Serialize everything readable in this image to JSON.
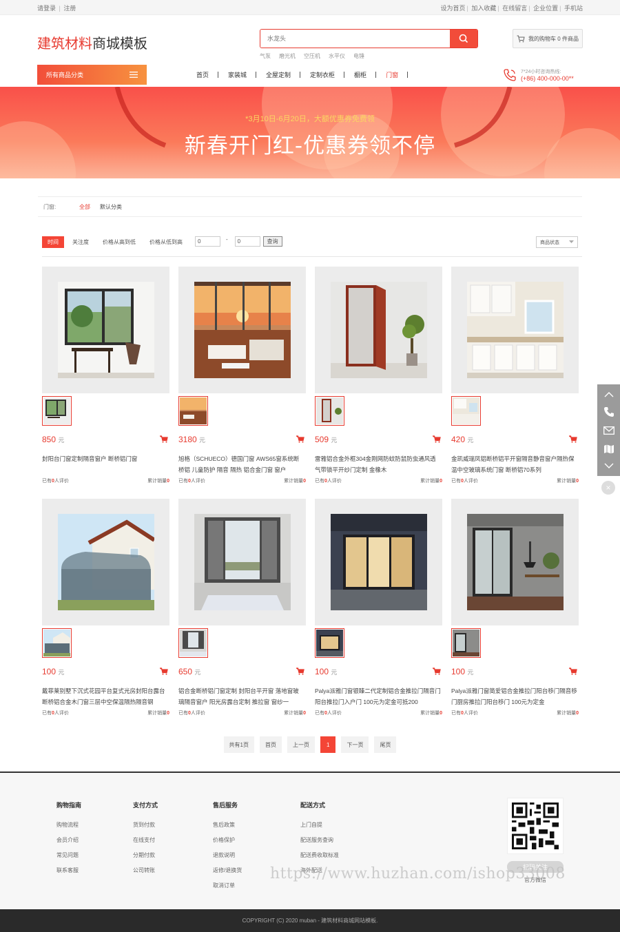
{
  "topbar": {
    "login": "请登录",
    "register": "注册",
    "right_links": [
      "设为首页",
      "加入收藏",
      "在线留言",
      "企业位置",
      "手机站"
    ]
  },
  "header": {
    "logo_red": "建筑材料",
    "logo_dark": "商城模板",
    "search_placeholder": "水龙头",
    "hotwords": [
      "气泵",
      "磨光机",
      "空压机",
      "水平仪",
      "电锤"
    ],
    "cart_text": "我的购物车 0 件商品"
  },
  "nav": {
    "all_categories": "所有商品分类",
    "items": [
      "首页",
      "家装城",
      "全屋定制",
      "定制衣柜",
      "橱柜",
      "门窗"
    ],
    "active_index": 5,
    "hotline_label": "7*24小时咨询热线:",
    "hotline_number": "(+86) 400-000-00**"
  },
  "banner": {
    "subtitle": "*3月10日-6月20日，大额优惠券免费领",
    "title": "新春开门红-优惠券领不停"
  },
  "filter": {
    "label": "门窗:",
    "options": [
      "全部",
      "默认分类"
    ]
  },
  "sortbar": {
    "sorts": [
      "时间",
      "关注度",
      "价格从高到低",
      "价格从低到高"
    ],
    "price_min": "0",
    "price_max": "0",
    "dash": "-",
    "query_label": "查询",
    "status_label": "商品状态"
  },
  "products": [
    {
      "price": "850",
      "unit": "元",
      "name": "封阳台门窗定制隔音窗户 断桥铝门窗",
      "reviews_prefix": "已有",
      "reviews": "0",
      "reviews_suffix": "人评价",
      "sales_label": "累计销量",
      "sales": "0"
    },
    {
      "price": "3180",
      "unit": "元",
      "name": "旭格（SCHUECO）德国门窗 AWS65窗系统断桥铝 儿童防护 隔音 隔热 铝合金门窗 窗户",
      "reviews_prefix": "已有",
      "reviews": "0",
      "reviews_suffix": "人评价",
      "sales_label": "累计销量",
      "sales": "0"
    },
    {
      "price": "509",
      "unit": "元",
      "name": "雷雅铝合金外框304金刚网防蚊防鼠防虫通风透气带锁平开纱门定制 金橡木",
      "reviews_prefix": "已有",
      "reviews": "0",
      "reviews_suffix": "人评价",
      "sales_label": "累计销量",
      "sales": "0"
    },
    {
      "price": "420",
      "unit": "元",
      "name": "金凯威瑞凤铝断桥铝平开窗隔音静音窗户隔热保温中空玻璃系统门窗 断桥铝70系列",
      "reviews_prefix": "已有",
      "reviews": "0",
      "reviews_suffix": "人评价",
      "sales_label": "累计销量",
      "sales": "0"
    },
    {
      "price": "100",
      "unit": "元",
      "name": "戴菲莱别墅下沉式花园平台复式光房封阳台露台断桥铝合金木门窗三层中空保温隔热隔音钢",
      "reviews_prefix": "已有",
      "reviews": "0",
      "reviews_suffix": "人评价",
      "sales_label": "累计销量",
      "sales": "0"
    },
    {
      "price": "650",
      "unit": "元",
      "name": "铝合金断桥铝门窗定制 封阳台平开窗 落地窗玻璃隔音窗户 阳光房露台定制 推拉窗 窗纱一",
      "reviews_prefix": "已有",
      "reviews": "0",
      "reviews_suffix": "人评价",
      "sales_label": "累计销量",
      "sales": "0"
    },
    {
      "price": "100",
      "unit": "元",
      "name": "Palya派雅门窗银臻二代定制铝合金推拉门隔音门阳台推拉门入户门 100元为定金可抵200",
      "reviews_prefix": "已有",
      "reviews": "0",
      "reviews_suffix": "人评价",
      "sales_label": "累计销量",
      "sales": "0"
    },
    {
      "price": "100",
      "unit": "元",
      "name": "Palya派雅门窗简爱铝合金推拉门阳台移门隔音移门厨房推拉门阳台移门 100元为定金",
      "reviews_prefix": "已有",
      "reviews": "0",
      "reviews_suffix": "人评价",
      "sales_label": "累计销量",
      "sales": "0"
    }
  ],
  "pager": {
    "total": "共有1页",
    "first": "首页",
    "prev": "上一页",
    "current": "1",
    "next": "下一页",
    "last": "尾页"
  },
  "footer": {
    "columns": [
      {
        "title": "购物指南",
        "items": [
          "购物流程",
          "会员介绍",
          "常见问题",
          "联系客服"
        ]
      },
      {
        "title": "支付方式",
        "items": [
          "货到付款",
          "在线支付",
          "分期付款",
          "公司转账"
        ]
      },
      {
        "title": "售后服务",
        "items": [
          "售后政策",
          "价格保护",
          "退款说明",
          "返修/退换货",
          "取消订单"
        ]
      },
      {
        "title": "配送方式",
        "items": [
          "上门自提",
          "配送服务查询",
          "配送费收取标准",
          "海外配送"
        ]
      }
    ],
    "qr_label": "扫码关注",
    "qr_sub": "官方微信",
    "watermark": "https://www.huzhan.com/ishop33008",
    "copyright": "COPYRIGHT (C) 2020 muban - 建筑材料商城网站模板."
  },
  "colors": {
    "accent": "#e73a2f",
    "banner": "#f9504a",
    "footer_bar": "#2a2a2a"
  }
}
